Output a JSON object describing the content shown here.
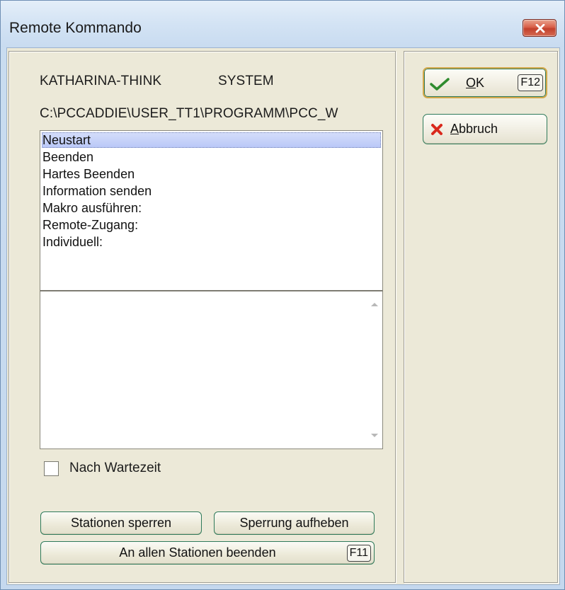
{
  "window": {
    "title": "Remote Kommando"
  },
  "info": {
    "computer": "KATHARINA-THINK",
    "user": "SYSTEM",
    "path": "C:\\PCCADDIE\\USER_TT1\\PROGRAMM\\PCC_W"
  },
  "commands": {
    "items": [
      {
        "label": "Neustart",
        "selected": true
      },
      {
        "label": "Beenden",
        "selected": false
      },
      {
        "label": "Hartes Beenden",
        "selected": false
      },
      {
        "label": "Information senden",
        "selected": false
      },
      {
        "label": "Makro ausführen:",
        "selected": false
      },
      {
        "label": "Remote-Zugang:",
        "selected": false
      },
      {
        "label": "Individuell:",
        "selected": false
      }
    ]
  },
  "details": {
    "value": ""
  },
  "wait_option": {
    "label": "Nach Wartezeit",
    "checked": false
  },
  "buttons": {
    "lock_stations": "Stationen sperren",
    "unlock": "Sperrung aufheben",
    "end_all": "An allen Stationen beenden",
    "end_all_key": "F11",
    "ok_mnemonic": "O",
    "ok_rest": "K",
    "ok_key": "F12",
    "cancel_mnemonic": "A",
    "cancel_rest": "bbruch"
  },
  "colors": {
    "dialog_background": "#ece9d8",
    "selection": "#c3cff8",
    "button_border": "#2f7a5a",
    "close_button": "#c9452f",
    "ok_icon": "#2e8b2e",
    "cancel_icon": "#d9281c"
  },
  "icons": {
    "ok": "check-icon",
    "cancel": "x-icon",
    "close": "close-icon"
  }
}
